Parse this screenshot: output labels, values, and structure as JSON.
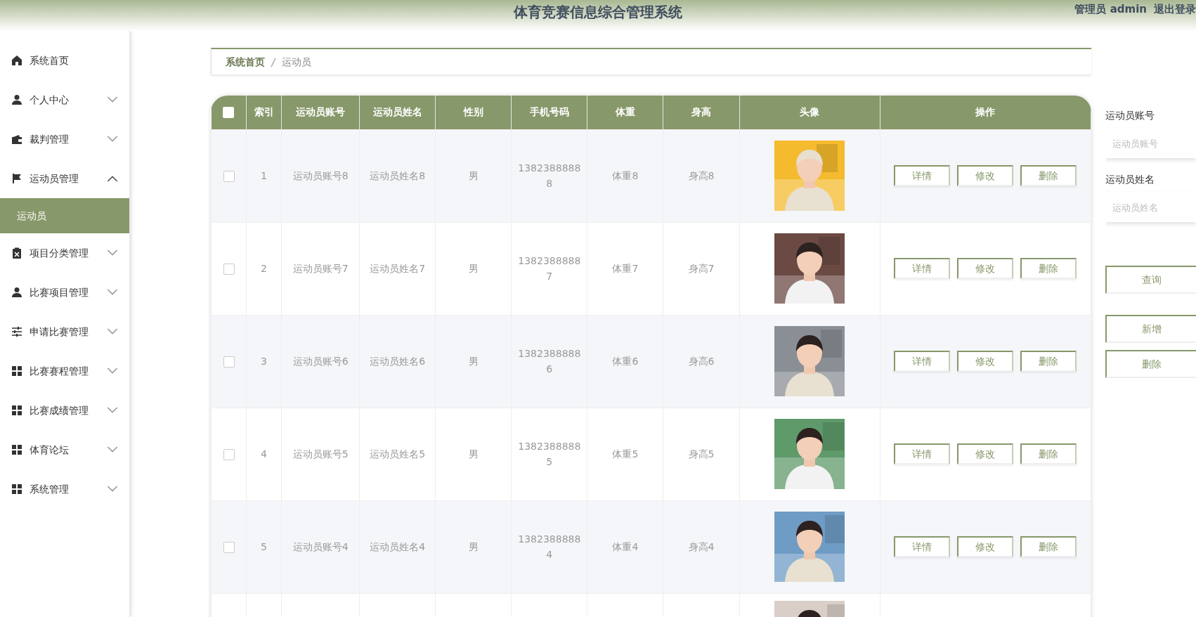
{
  "header": {
    "title": "体育竞赛信息综合管理系统",
    "user": "管理员 admin",
    "logout": "退出登录"
  },
  "sidebar": {
    "items": [
      {
        "label": "系统首页"
      },
      {
        "label": "个人中心",
        "expanded": false
      },
      {
        "label": "裁判管理",
        "expanded": false
      },
      {
        "label": "运动员管理",
        "expanded": true,
        "children": [
          {
            "label": "运动员",
            "selected": true
          }
        ]
      },
      {
        "label": "项目分类管理",
        "expanded": false
      },
      {
        "label": "比赛项目管理",
        "expanded": false
      },
      {
        "label": "申请比赛管理",
        "expanded": false
      },
      {
        "label": "比赛赛程管理",
        "expanded": false
      },
      {
        "label": "比赛成绩管理",
        "expanded": false
      },
      {
        "label": "体育论坛",
        "expanded": false
      },
      {
        "label": "系统管理",
        "expanded": false
      }
    ]
  },
  "breadcrumb": [
    "系统首页",
    "运动员"
  ],
  "table": {
    "columns": [
      "索引",
      "运动员账号",
      "运动员姓名",
      "性别",
      "手机号码",
      "体重",
      "身高",
      "头像",
      "操作"
    ],
    "header_checked": false,
    "rows": [
      {
        "checked": false,
        "cells": [
          "1",
          "运动员账号8",
          "运动员姓名8",
          "男",
          "13823888888",
          "体重8",
          "身高8"
        ],
        "photo": {
          "kind": "picture"
        },
        "actions": [
          "详情",
          "修改",
          "删除"
        ]
      },
      {
        "checked": false,
        "cells": [
          "2",
          "运动员账号7",
          "运动员姓名7",
          "男",
          "13823888887",
          "体重7",
          "身高7"
        ],
        "photo": {
          "kind": "picture"
        },
        "actions": [
          "详情",
          "修改",
          "删除"
        ]
      },
      {
        "checked": false,
        "cells": [
          "3",
          "运动员账号6",
          "运动员姓名6",
          "男",
          "13823888886",
          "体重6",
          "身高6"
        ],
        "photo": {
          "kind": "picture"
        },
        "actions": [
          "详情",
          "修改",
          "删除"
        ]
      },
      {
        "checked": false,
        "cells": [
          "4",
          "运动员账号5",
          "运动员姓名5",
          "男",
          "13823888885",
          "体重5",
          "身高5"
        ],
        "photo": {
          "kind": "picture"
        },
        "actions": [
          "详情",
          "修改",
          "删除"
        ]
      },
      {
        "checked": false,
        "cells": [
          "5",
          "运动员账号4",
          "运动员姓名4",
          "男",
          "13823888884",
          "体重4",
          "身高4"
        ],
        "photo": {
          "kind": "picture"
        },
        "actions": [
          "详情",
          "修改",
          "删除"
        ]
      },
      {
        "cells": [],
        "photo": {
          "kind": "picture"
        },
        "actions": []
      }
    ]
  },
  "search": {
    "fields": [
      {
        "label": "运动员账号",
        "placeholder": "运动员账号"
      },
      {
        "label": "运动员姓名",
        "placeholder": "运动员姓名"
      }
    ],
    "buttons": [
      {
        "kind": "query",
        "label": "查询"
      },
      {
        "kind": "add",
        "label": "新增"
      },
      {
        "kind": "delete",
        "label": "删除"
      }
    ]
  }
}
